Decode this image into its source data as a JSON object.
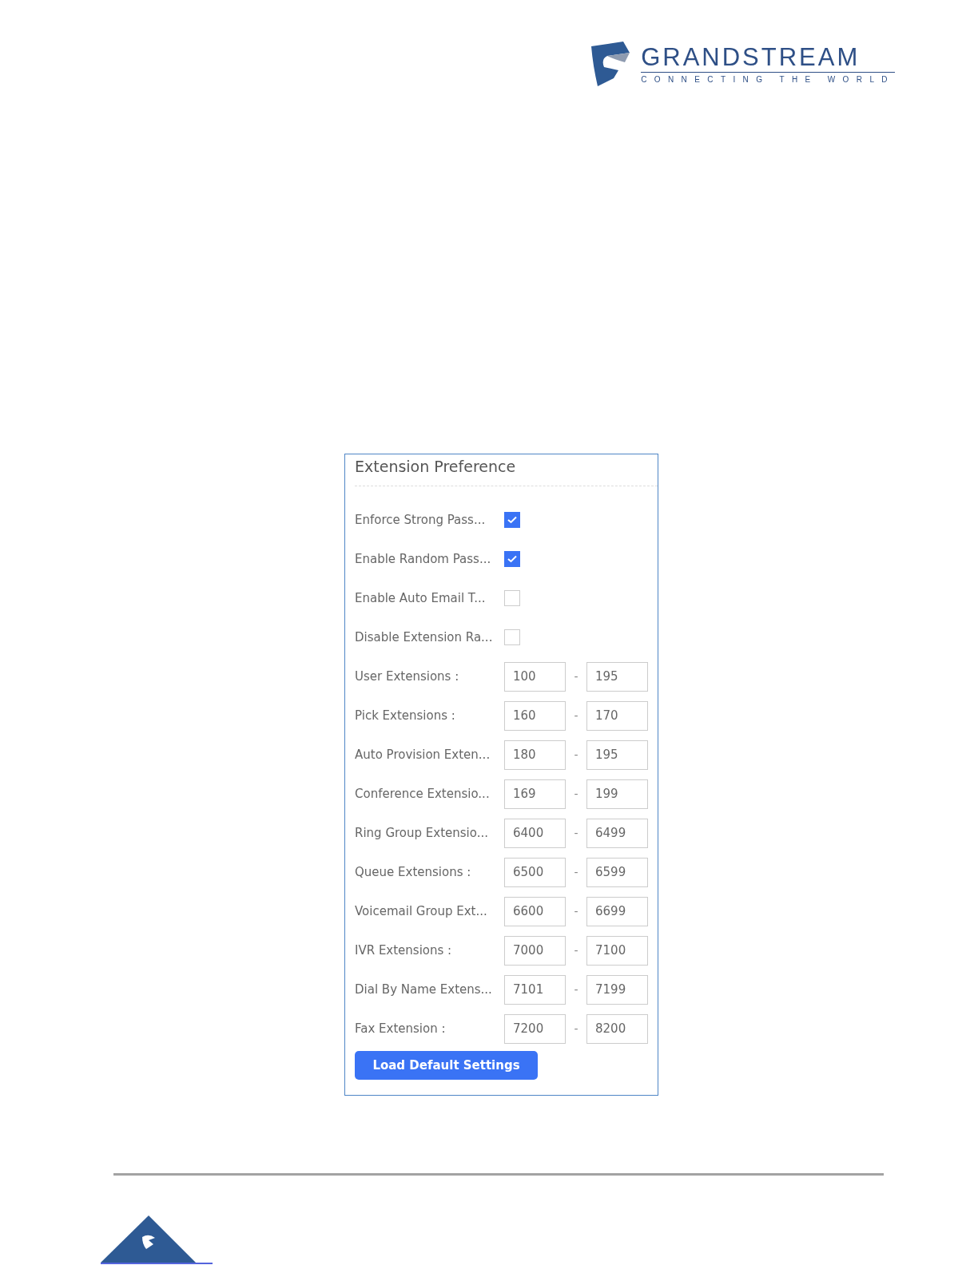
{
  "logo": {
    "name": "GRANDSTREAM",
    "tagline": "CONNECTING THE WORLD"
  },
  "panel": {
    "title": "Extension Preference",
    "rows": [
      {
        "kind": "checkbox",
        "label": "Enforce Strong Pass...",
        "checked": true
      },
      {
        "kind": "checkbox",
        "label": "Enable Random Pass...",
        "checked": true
      },
      {
        "kind": "checkbox",
        "label": "Enable Auto Email T...",
        "checked": false
      },
      {
        "kind": "checkbox",
        "label": "Disable Extension Ra...",
        "checked": false
      },
      {
        "kind": "range",
        "label": "User Extensions :",
        "from": "100",
        "separator": "-",
        "to": "195"
      },
      {
        "kind": "range",
        "label": "Pick Extensions :",
        "from": "160",
        "separator": "-",
        "to": "170"
      },
      {
        "kind": "range",
        "label": "Auto Provision Exten...",
        "from": "180",
        "separator": "-",
        "to": "195"
      },
      {
        "kind": "range",
        "label": "Conference Extensio...",
        "from": "169",
        "separator": "-",
        "to": "199"
      },
      {
        "kind": "range",
        "label": "Ring Group Extensio...",
        "from": "6400",
        "separator": "-",
        "to": "6499"
      },
      {
        "kind": "range",
        "label": "Queue Extensions :",
        "from": "6500",
        "separator": "-",
        "to": "6599"
      },
      {
        "kind": "range",
        "label": "Voicemail Group Ext...",
        "from": "6600",
        "separator": "-",
        "to": "6699"
      },
      {
        "kind": "range",
        "label": "IVR Extensions :",
        "from": "7000",
        "separator": "-",
        "to": "7100"
      },
      {
        "kind": "range",
        "label": "Dial By Name Extens...",
        "from": "7101",
        "separator": "-",
        "to": "7199"
      },
      {
        "kind": "range",
        "label": "Fax Extension :",
        "from": "7200",
        "separator": "-",
        "to": "8200"
      }
    ],
    "button": "Load Default Settings"
  }
}
